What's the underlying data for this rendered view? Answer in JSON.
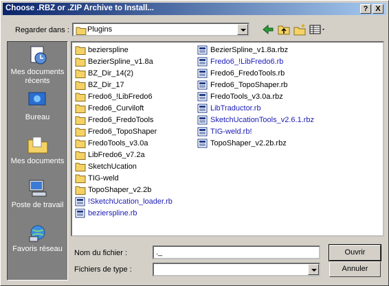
{
  "window": {
    "title": "Choose .RBZ or .ZIP Archive to Install...",
    "help_label": "?",
    "close_label": "X"
  },
  "toolbar": {
    "look_in_label": "Regarder dans :",
    "look_in_value": "Plugins",
    "back_icon": "back-arrow-icon",
    "up_icon": "up-folder-icon",
    "new_folder_icon": "new-folder-icon",
    "views_icon": "views-menu-icon"
  },
  "places": [
    {
      "label": "Mes documents récents",
      "icon": "recent-documents-icon"
    },
    {
      "label": "Bureau",
      "icon": "desktop-icon"
    },
    {
      "label": "Mes documents",
      "icon": "my-documents-icon"
    },
    {
      "label": "Poste de travail",
      "icon": "my-computer-icon"
    },
    {
      "label": "Favoris réseau",
      "icon": "network-places-icon"
    }
  ],
  "files": {
    "column1": [
      {
        "name": "bezierspline",
        "kind": "folder"
      },
      {
        "name": "BezierSpline_v1.8a",
        "kind": "folder"
      },
      {
        "name": "BZ_Dir_14(2)",
        "kind": "folder"
      },
      {
        "name": "BZ_Dir_17",
        "kind": "folder"
      },
      {
        "name": "Fredo6_!LibFredo6",
        "kind": "folder"
      },
      {
        "name": "Fredo6_Curviloft",
        "kind": "folder"
      },
      {
        "name": "Fredo6_FredoTools",
        "kind": "folder"
      },
      {
        "name": "Fredo6_TopoShaper",
        "kind": "folder"
      },
      {
        "name": "FredoTools_v3.0a",
        "kind": "folder"
      },
      {
        "name": "LibFredo6_v7.2a",
        "kind": "folder"
      },
      {
        "name": "SketchUcation",
        "kind": "folder"
      },
      {
        "name": "TIG-weld",
        "kind": "folder"
      },
      {
        "name": "TopoShaper_v2.2b",
        "kind": "folder"
      },
      {
        "name": "!SketchUcation_loader.rb",
        "kind": "file-blue"
      },
      {
        "name": "bezierspline.rb",
        "kind": "file-blue"
      }
    ],
    "column2": [
      {
        "name": "BezierSpline_v1.8a.rbz",
        "kind": "file"
      },
      {
        "name": "Fredo6_!LibFredo6.rb",
        "kind": "file-blue"
      },
      {
        "name": "Fredo6_FredoTools.rb",
        "kind": "file"
      },
      {
        "name": "Fredo6_TopoShaper.rb",
        "kind": "file"
      },
      {
        "name": "FredoTools_v3.0a.rbz",
        "kind": "file"
      },
      {
        "name": "LibTraductor.rb",
        "kind": "file-blue"
      },
      {
        "name": "SketchUcationTools_v2.6.1.rbz",
        "kind": "file-blue"
      },
      {
        "name": "TIG-weld.rb!",
        "kind": "file-blue"
      },
      {
        "name": "TopoShaper_v2.2b.rbz",
        "kind": "file"
      }
    ]
  },
  "form": {
    "filename_label": "Nom du fichier :",
    "filename_value": "._",
    "filetype_label": "Fichiers de type :",
    "filetype_value": ""
  },
  "buttons": {
    "open_label": "Ouvrir",
    "cancel_label": "Annuler"
  },
  "colors": {
    "title_gradient_start": "#0a246a",
    "title_gradient_end": "#a6caf0",
    "places_bg": "#808080",
    "highlight_text": "#1a1ab4",
    "folder_yellow": "#f4d266"
  }
}
